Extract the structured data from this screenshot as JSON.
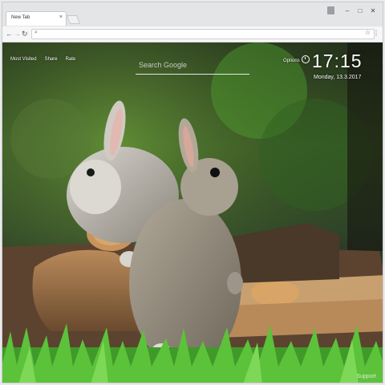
{
  "tab": {
    "title": "New Tab",
    "close_glyph": "×"
  },
  "window_controls": {
    "minimize": "‒",
    "maximize": "□",
    "close": "✕"
  },
  "toolbar": {
    "back_glyph": "←",
    "forward_glyph": "→",
    "reload_glyph": "↻",
    "omnibox_value": "",
    "search_glyph": "⌕",
    "star_glyph": "☆",
    "menu_glyph": "⋮"
  },
  "newtab": {
    "links": [
      "Most Visited",
      "Share",
      "Rate"
    ],
    "search_placeholder": "Search Google",
    "options_label": "Options",
    "time": "17:15",
    "date": "Monday, 13.3.2017",
    "support_label": "Support"
  },
  "colors": {
    "background_subject": "two grey rabbits on a log in green grass",
    "text": "#ffffff"
  }
}
